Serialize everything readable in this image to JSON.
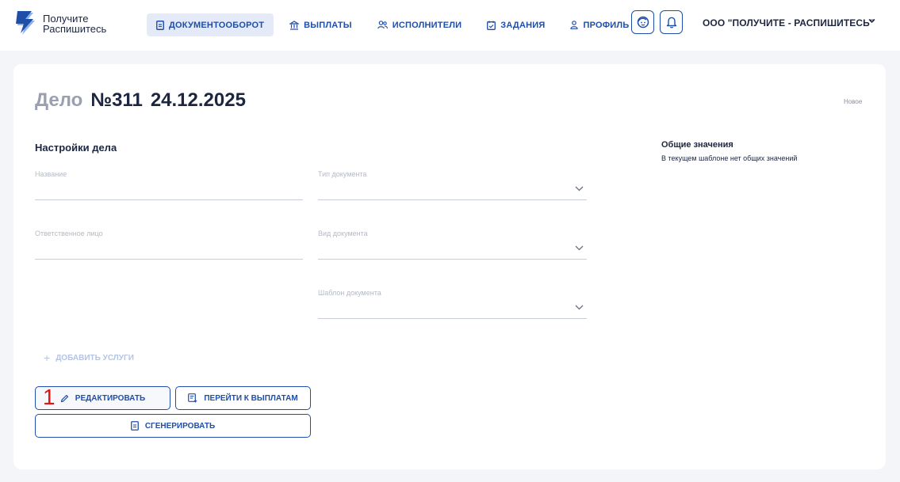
{
  "brand": {
    "line1": "Получите",
    "line2": "Распишитесь",
    "icon": "lightning-logo-icon",
    "accent": "#1f4ea8"
  },
  "nav": [
    {
      "label": "ДОКУМЕНТООБОРОТ",
      "icon": "document-icon",
      "active": true
    },
    {
      "label": "ВЫПЛАТЫ",
      "icon": "bank-icon",
      "active": false
    },
    {
      "label": "ИСПОЛНИТЕЛИ",
      "icon": "users-icon",
      "active": false
    },
    {
      "label": "ЗАДАНИЯ",
      "icon": "calendar-check-icon",
      "active": false
    },
    {
      "label": "ПРОФИЛЬ",
      "icon": "user-icon",
      "active": false
    }
  ],
  "header": {
    "support_icon": "support-face-icon",
    "notifications_icon": "bell-icon",
    "organization": "ООО \"ПОЛУЧИТЕ - РАСПИШИТЕСЬ\""
  },
  "case": {
    "prefix": "Дело",
    "number": "№311",
    "date": "24.12.2025",
    "status": "Новое"
  },
  "settings": {
    "title": "Настройки дела",
    "fields": {
      "name": {
        "label": "Название",
        "value": ""
      },
      "doc_type": {
        "label": "Тип документа",
        "value": ""
      },
      "responsible": {
        "label": "Ответственное лицо",
        "value": ""
      },
      "doc_kind": {
        "label": "Вид документа",
        "value": ""
      },
      "template": {
        "label": "Шаблон документа",
        "value": ""
      }
    },
    "add_services": "ДОБАВИТЬ УСЛУГИ"
  },
  "actions": {
    "edit": "РЕДАКТИРОВАТЬ",
    "go_to_payments": "ПЕРЕЙТИ К ВЫПЛАТАМ",
    "generate": "СГЕНЕРИРОВАТЬ"
  },
  "annotation": {
    "marker": "1",
    "color": "#e01414"
  },
  "common_values": {
    "title": "Общие значения",
    "text": "В текущем шаблоне нет общих значений"
  }
}
